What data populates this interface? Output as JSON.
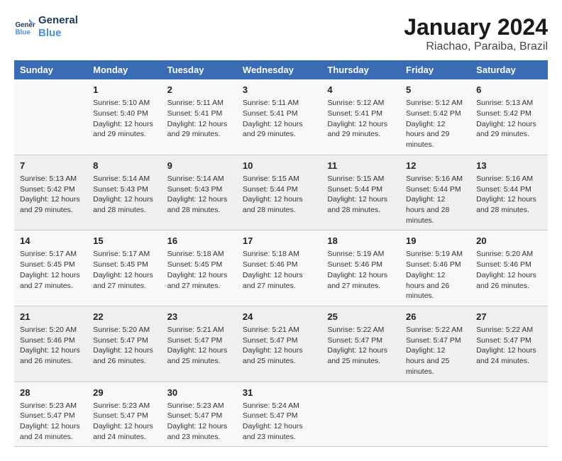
{
  "logo": {
    "line1": "General",
    "line2": "Blue"
  },
  "title": "January 2024",
  "subtitle": "Riachao, Paraiba, Brazil",
  "days_header": [
    "Sunday",
    "Monday",
    "Tuesday",
    "Wednesday",
    "Thursday",
    "Friday",
    "Saturday"
  ],
  "weeks": [
    [
      {
        "day": "",
        "info": ""
      },
      {
        "day": "1",
        "sunrise": "Sunrise: 5:10 AM",
        "sunset": "Sunset: 5:40 PM",
        "daylight": "Daylight: 12 hours and 29 minutes."
      },
      {
        "day": "2",
        "sunrise": "Sunrise: 5:11 AM",
        "sunset": "Sunset: 5:41 PM",
        "daylight": "Daylight: 12 hours and 29 minutes."
      },
      {
        "day": "3",
        "sunrise": "Sunrise: 5:11 AM",
        "sunset": "Sunset: 5:41 PM",
        "daylight": "Daylight: 12 hours and 29 minutes."
      },
      {
        "day": "4",
        "sunrise": "Sunrise: 5:12 AM",
        "sunset": "Sunset: 5:41 PM",
        "daylight": "Daylight: 12 hours and 29 minutes."
      },
      {
        "day": "5",
        "sunrise": "Sunrise: 5:12 AM",
        "sunset": "Sunset: 5:42 PM",
        "daylight": "Daylight: 12 hours and 29 minutes."
      },
      {
        "day": "6",
        "sunrise": "Sunrise: 5:13 AM",
        "sunset": "Sunset: 5:42 PM",
        "daylight": "Daylight: 12 hours and 29 minutes."
      }
    ],
    [
      {
        "day": "7",
        "sunrise": "Sunrise: 5:13 AM",
        "sunset": "Sunset: 5:42 PM",
        "daylight": "Daylight: 12 hours and 29 minutes."
      },
      {
        "day": "8",
        "sunrise": "Sunrise: 5:14 AM",
        "sunset": "Sunset: 5:43 PM",
        "daylight": "Daylight: 12 hours and 28 minutes."
      },
      {
        "day": "9",
        "sunrise": "Sunrise: 5:14 AM",
        "sunset": "Sunset: 5:43 PM",
        "daylight": "Daylight: 12 hours and 28 minutes."
      },
      {
        "day": "10",
        "sunrise": "Sunrise: 5:15 AM",
        "sunset": "Sunset: 5:44 PM",
        "daylight": "Daylight: 12 hours and 28 minutes."
      },
      {
        "day": "11",
        "sunrise": "Sunrise: 5:15 AM",
        "sunset": "Sunset: 5:44 PM",
        "daylight": "Daylight: 12 hours and 28 minutes."
      },
      {
        "day": "12",
        "sunrise": "Sunrise: 5:16 AM",
        "sunset": "Sunset: 5:44 PM",
        "daylight": "Daylight: 12 hours and 28 minutes."
      },
      {
        "day": "13",
        "sunrise": "Sunrise: 5:16 AM",
        "sunset": "Sunset: 5:44 PM",
        "daylight": "Daylight: 12 hours and 28 minutes."
      }
    ],
    [
      {
        "day": "14",
        "sunrise": "Sunrise: 5:17 AM",
        "sunset": "Sunset: 5:45 PM",
        "daylight": "Daylight: 12 hours and 27 minutes."
      },
      {
        "day": "15",
        "sunrise": "Sunrise: 5:17 AM",
        "sunset": "Sunset: 5:45 PM",
        "daylight": "Daylight: 12 hours and 27 minutes."
      },
      {
        "day": "16",
        "sunrise": "Sunrise: 5:18 AM",
        "sunset": "Sunset: 5:45 PM",
        "daylight": "Daylight: 12 hours and 27 minutes."
      },
      {
        "day": "17",
        "sunrise": "Sunrise: 5:18 AM",
        "sunset": "Sunset: 5:46 PM",
        "daylight": "Daylight: 12 hours and 27 minutes."
      },
      {
        "day": "18",
        "sunrise": "Sunrise: 5:19 AM",
        "sunset": "Sunset: 5:46 PM",
        "daylight": "Daylight: 12 hours and 27 minutes."
      },
      {
        "day": "19",
        "sunrise": "Sunrise: 5:19 AM",
        "sunset": "Sunset: 5:46 PM",
        "daylight": "Daylight: 12 hours and 26 minutes."
      },
      {
        "day": "20",
        "sunrise": "Sunrise: 5:20 AM",
        "sunset": "Sunset: 5:46 PM",
        "daylight": "Daylight: 12 hours and 26 minutes."
      }
    ],
    [
      {
        "day": "21",
        "sunrise": "Sunrise: 5:20 AM",
        "sunset": "Sunset: 5:46 PM",
        "daylight": "Daylight: 12 hours and 26 minutes."
      },
      {
        "day": "22",
        "sunrise": "Sunrise: 5:20 AM",
        "sunset": "Sunset: 5:47 PM",
        "daylight": "Daylight: 12 hours and 26 minutes."
      },
      {
        "day": "23",
        "sunrise": "Sunrise: 5:21 AM",
        "sunset": "Sunset: 5:47 PM",
        "daylight": "Daylight: 12 hours and 25 minutes."
      },
      {
        "day": "24",
        "sunrise": "Sunrise: 5:21 AM",
        "sunset": "Sunset: 5:47 PM",
        "daylight": "Daylight: 12 hours and 25 minutes."
      },
      {
        "day": "25",
        "sunrise": "Sunrise: 5:22 AM",
        "sunset": "Sunset: 5:47 PM",
        "daylight": "Daylight: 12 hours and 25 minutes."
      },
      {
        "day": "26",
        "sunrise": "Sunrise: 5:22 AM",
        "sunset": "Sunset: 5:47 PM",
        "daylight": "Daylight: 12 hours and 25 minutes."
      },
      {
        "day": "27",
        "sunrise": "Sunrise: 5:22 AM",
        "sunset": "Sunset: 5:47 PM",
        "daylight": "Daylight: 12 hours and 24 minutes."
      }
    ],
    [
      {
        "day": "28",
        "sunrise": "Sunrise: 5:23 AM",
        "sunset": "Sunset: 5:47 PM",
        "daylight": "Daylight: 12 hours and 24 minutes."
      },
      {
        "day": "29",
        "sunrise": "Sunrise: 5:23 AM",
        "sunset": "Sunset: 5:47 PM",
        "daylight": "Daylight: 12 hours and 24 minutes."
      },
      {
        "day": "30",
        "sunrise": "Sunrise: 5:23 AM",
        "sunset": "Sunset: 5:47 PM",
        "daylight": "Daylight: 12 hours and 23 minutes."
      },
      {
        "day": "31",
        "sunrise": "Sunrise: 5:24 AM",
        "sunset": "Sunset: 5:47 PM",
        "daylight": "Daylight: 12 hours and 23 minutes."
      },
      {
        "day": "",
        "info": ""
      },
      {
        "day": "",
        "info": ""
      },
      {
        "day": "",
        "info": ""
      }
    ]
  ]
}
